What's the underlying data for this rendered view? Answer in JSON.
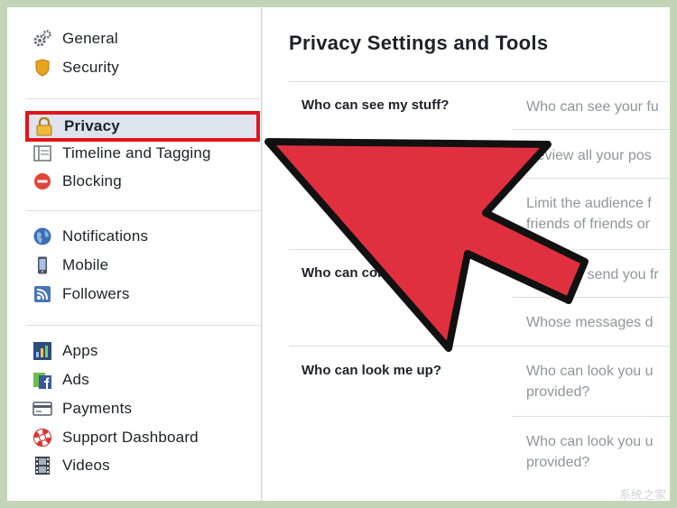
{
  "sidebar": {
    "groups": [
      [
        {
          "label": "General",
          "icon": "gears-icon"
        },
        {
          "label": "Security",
          "icon": "shield-icon"
        }
      ],
      [
        {
          "label": "Privacy",
          "icon": "lock-icon",
          "active": true
        },
        {
          "label": "Timeline and Tagging",
          "icon": "timeline-icon"
        },
        {
          "label": "Blocking",
          "icon": "blocking-icon"
        }
      ],
      [
        {
          "label": "Notifications",
          "icon": "globe-icon"
        },
        {
          "label": "Mobile",
          "icon": "mobile-icon"
        },
        {
          "label": "Followers",
          "icon": "rss-icon"
        }
      ],
      [
        {
          "label": "Apps",
          "icon": "apps-icon"
        },
        {
          "label": "Ads",
          "icon": "ads-icon"
        },
        {
          "label": "Payments",
          "icon": "card-icon"
        },
        {
          "label": "Support Dashboard",
          "icon": "lifebuoy-icon"
        },
        {
          "label": "Videos",
          "icon": "film-icon"
        }
      ]
    ]
  },
  "main": {
    "title": "Privacy Settings and Tools",
    "sections": [
      {
        "label": "Who can see my stuff?",
        "rows": [
          "Who can see your fu",
          "Review all your pos",
          "Limit the audience f\nfriends of friends or"
        ]
      },
      {
        "label": "Who can contact me?",
        "rows": [
          "Who can send you fr",
          "Whose messages d"
        ]
      },
      {
        "label": "Who can look me up?",
        "rows": [
          "Who can look you u\nprovided?",
          "Who can look you u\nprovided?"
        ]
      }
    ]
  },
  "colors": {
    "highlight_border": "#e0141b",
    "arrow_fill": "#e03040",
    "background": "#c3d5b6"
  },
  "watermark": "系统之家"
}
